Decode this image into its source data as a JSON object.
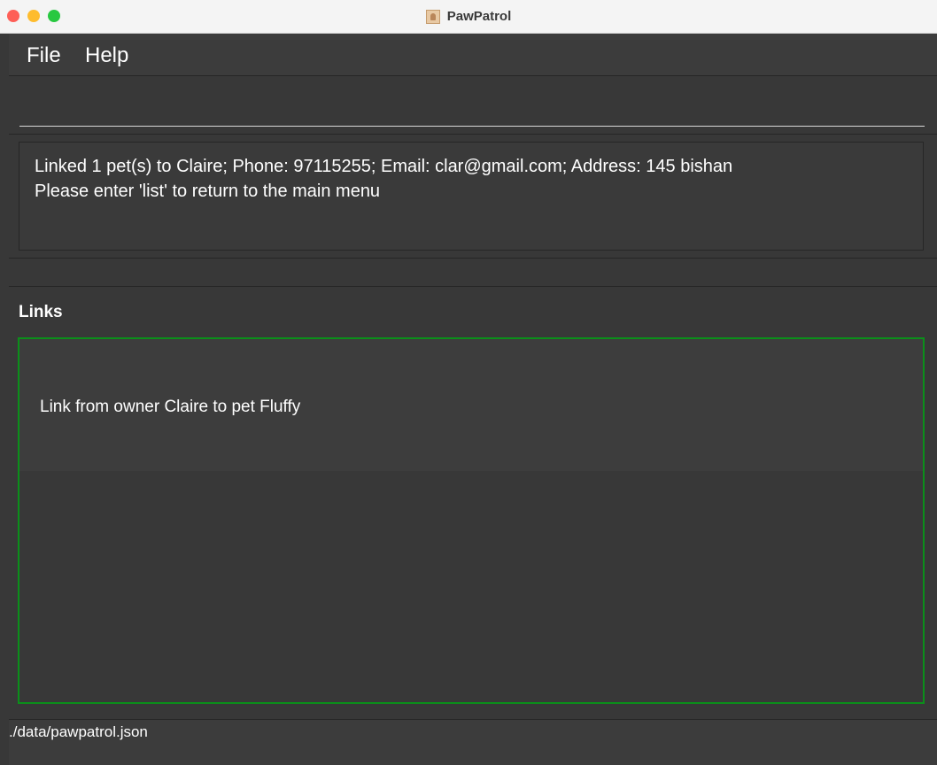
{
  "window": {
    "title": "PawPatrol"
  },
  "menu": {
    "file_label": "File",
    "help_label": "Help"
  },
  "command": {
    "value": "",
    "placeholder": ""
  },
  "result": {
    "line1": "Linked 1 pet(s) to Claire; Phone: 97115255; Email: clar@gmail.com; Address: 145 bishan",
    "line2": "Please enter 'list' to return to the main menu"
  },
  "links": {
    "heading": "Links",
    "items": [
      {
        "text": "Link from owner Claire to pet Fluffy"
      }
    ]
  },
  "status": {
    "file_path": "./data/pawpatrol.json"
  },
  "colors": {
    "accent_border": "#0b8f1a",
    "background": "#383838",
    "close": "#fe5f57",
    "minimize": "#febc2e",
    "maximize": "#28c840"
  }
}
